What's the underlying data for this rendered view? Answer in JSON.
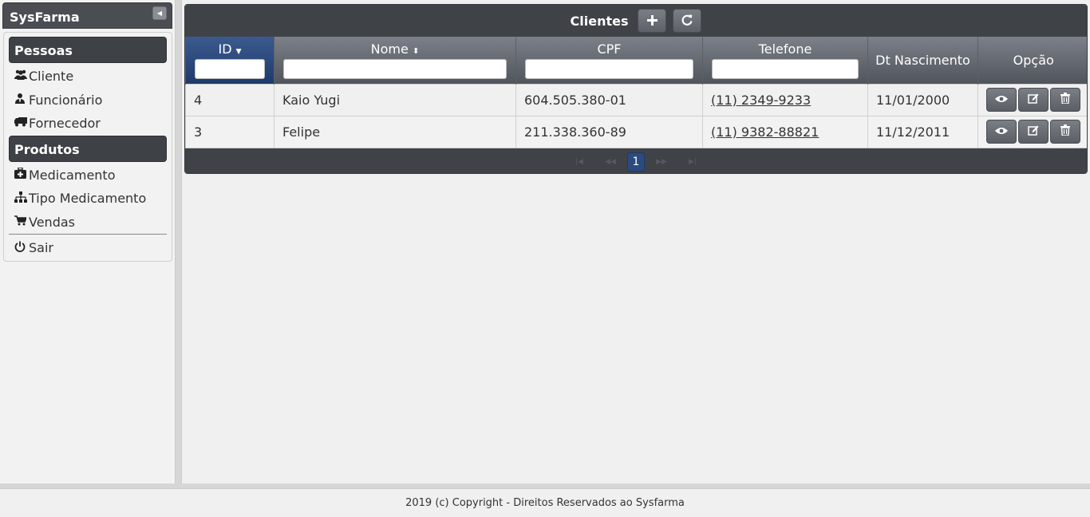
{
  "app": {
    "title": "SysFarma"
  },
  "sidebar": {
    "categories": [
      {
        "label": "Pessoas",
        "items": [
          {
            "label": "Cliente",
            "icon": "users-icon"
          },
          {
            "label": "Funcionário",
            "icon": "user-tie-icon"
          },
          {
            "label": "Fornecedor",
            "icon": "truck-icon"
          }
        ]
      },
      {
        "label": "Produtos",
        "items": [
          {
            "label": "Medicamento",
            "icon": "medkit-icon"
          },
          {
            "label": "Tipo Medicamento",
            "icon": "sitemap-icon"
          },
          {
            "label": "Vendas",
            "icon": "cart-icon"
          }
        ]
      }
    ],
    "logout": {
      "label": "Sair",
      "icon": "power-icon"
    }
  },
  "panel": {
    "title": "Clientes",
    "columns": {
      "id": "ID",
      "nome": "Nome",
      "cpf": "CPF",
      "telefone": "Telefone",
      "dt_nascimento": "Dt Nascimento",
      "opcao": "Opção"
    },
    "rows": [
      {
        "id": "4",
        "nome": "Kaio Yugi",
        "cpf": "604.505.380-01",
        "telefone": "(11) 2349-9233",
        "dt_nascimento": "11/01/2000"
      },
      {
        "id": "3",
        "nome": "Felipe",
        "cpf": "211.338.360-89",
        "telefone": "(11) 9382-88821",
        "dt_nascimento": "11/12/2011"
      }
    ],
    "paginator": {
      "current_page": "1"
    }
  },
  "footer": {
    "text": "2019 (c) Copyright - Direitos Reservados ao Sysfarma"
  }
}
